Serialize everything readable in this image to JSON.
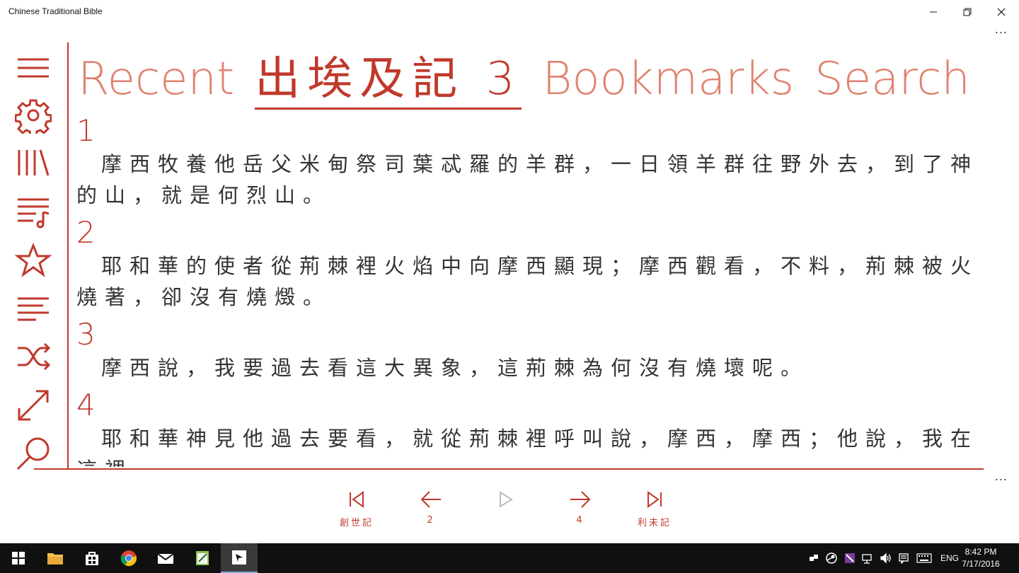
{
  "window": {
    "title": "Chinese Traditional Bible",
    "more": "..."
  },
  "sidebar": {
    "icons": [
      "hamburger-menu-icon",
      "gear-icon",
      "library-icon",
      "playlist-icon",
      "star-icon",
      "align-left-icon",
      "shuffle-icon",
      "resize-arrow-icon",
      "search-icon"
    ]
  },
  "pivot": {
    "items": [
      {
        "label": "Recent"
      },
      {
        "label": "出埃及記 3",
        "active": true
      },
      {
        "label": "Bookmarks"
      },
      {
        "label": "Search"
      }
    ]
  },
  "verses": [
    {
      "num": "1",
      "text": "摩西牧養他岳父米甸祭司葉忒羅的羊群，一日領羊群往野外去，到了神的山，就是何烈山。"
    },
    {
      "num": "2",
      "text": "耶和華的使者從荊棘裡火焰中向摩西顯現；摩西觀看，不料，荊棘被火燒著，卻沒有燒燬。"
    },
    {
      "num": "3",
      "text": "摩西說，我要過去看這大異象，這荊棘為何沒有燒壞呢。"
    },
    {
      "num": "4",
      "text": "耶和華神見他過去要看，就從荊棘裡呼叫說，摩西，摩西；他說，我在這裡。"
    }
  ],
  "bottom_nav": {
    "first_label": "創世記",
    "prev_label": "2",
    "next_label": "4",
    "last_label": "利未記",
    "more": "..."
  },
  "taskbar": {
    "lang": "ENG",
    "time": "8:42 PM",
    "date": "7/17/2016"
  },
  "colors": {
    "accent": "#c0392b",
    "accent_light": "#e0826f",
    "taskbar": "#101010"
  }
}
